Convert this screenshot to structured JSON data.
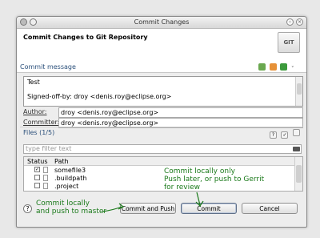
{
  "window": {
    "title": "Commit Changes"
  },
  "header": {
    "title": "Commit Changes to Git Repository",
    "logo_text": "GIT"
  },
  "commit_message": {
    "section_label": "Commit message",
    "line1": "Test",
    "line2": "Signed-off-by: droy <denis.roy@eclipse.org>"
  },
  "author": {
    "label": "Author:",
    "value": "droy <denis.roy@eclipse.org>"
  },
  "committer": {
    "label": "Committer:",
    "value": "droy <denis.roy@eclipse.org>"
  },
  "files": {
    "label": "Files (1/5)",
    "filter_placeholder": "type filter text",
    "columns": {
      "status": "Status",
      "path": "Path"
    },
    "rows": [
      {
        "checked": "✓",
        "path": "somefile3"
      },
      {
        "checked": "",
        "path": ".buildpath"
      },
      {
        "checked": "",
        "path": ".project"
      }
    ]
  },
  "buttons": {
    "help": "?",
    "commit_and_push": "Commit and Push",
    "commit": "Commit",
    "cancel": "Cancel"
  },
  "annotations": {
    "commit_push_line1": "Commit locally",
    "commit_push_line2": "and push to master",
    "commit_line1": "Commit locally only",
    "commit_line2": "Push later, or push to Gerrit",
    "commit_line3": "for review"
  },
  "colors": {
    "annotation": "#1b7a1b",
    "section_label": "#2a4f7a"
  }
}
